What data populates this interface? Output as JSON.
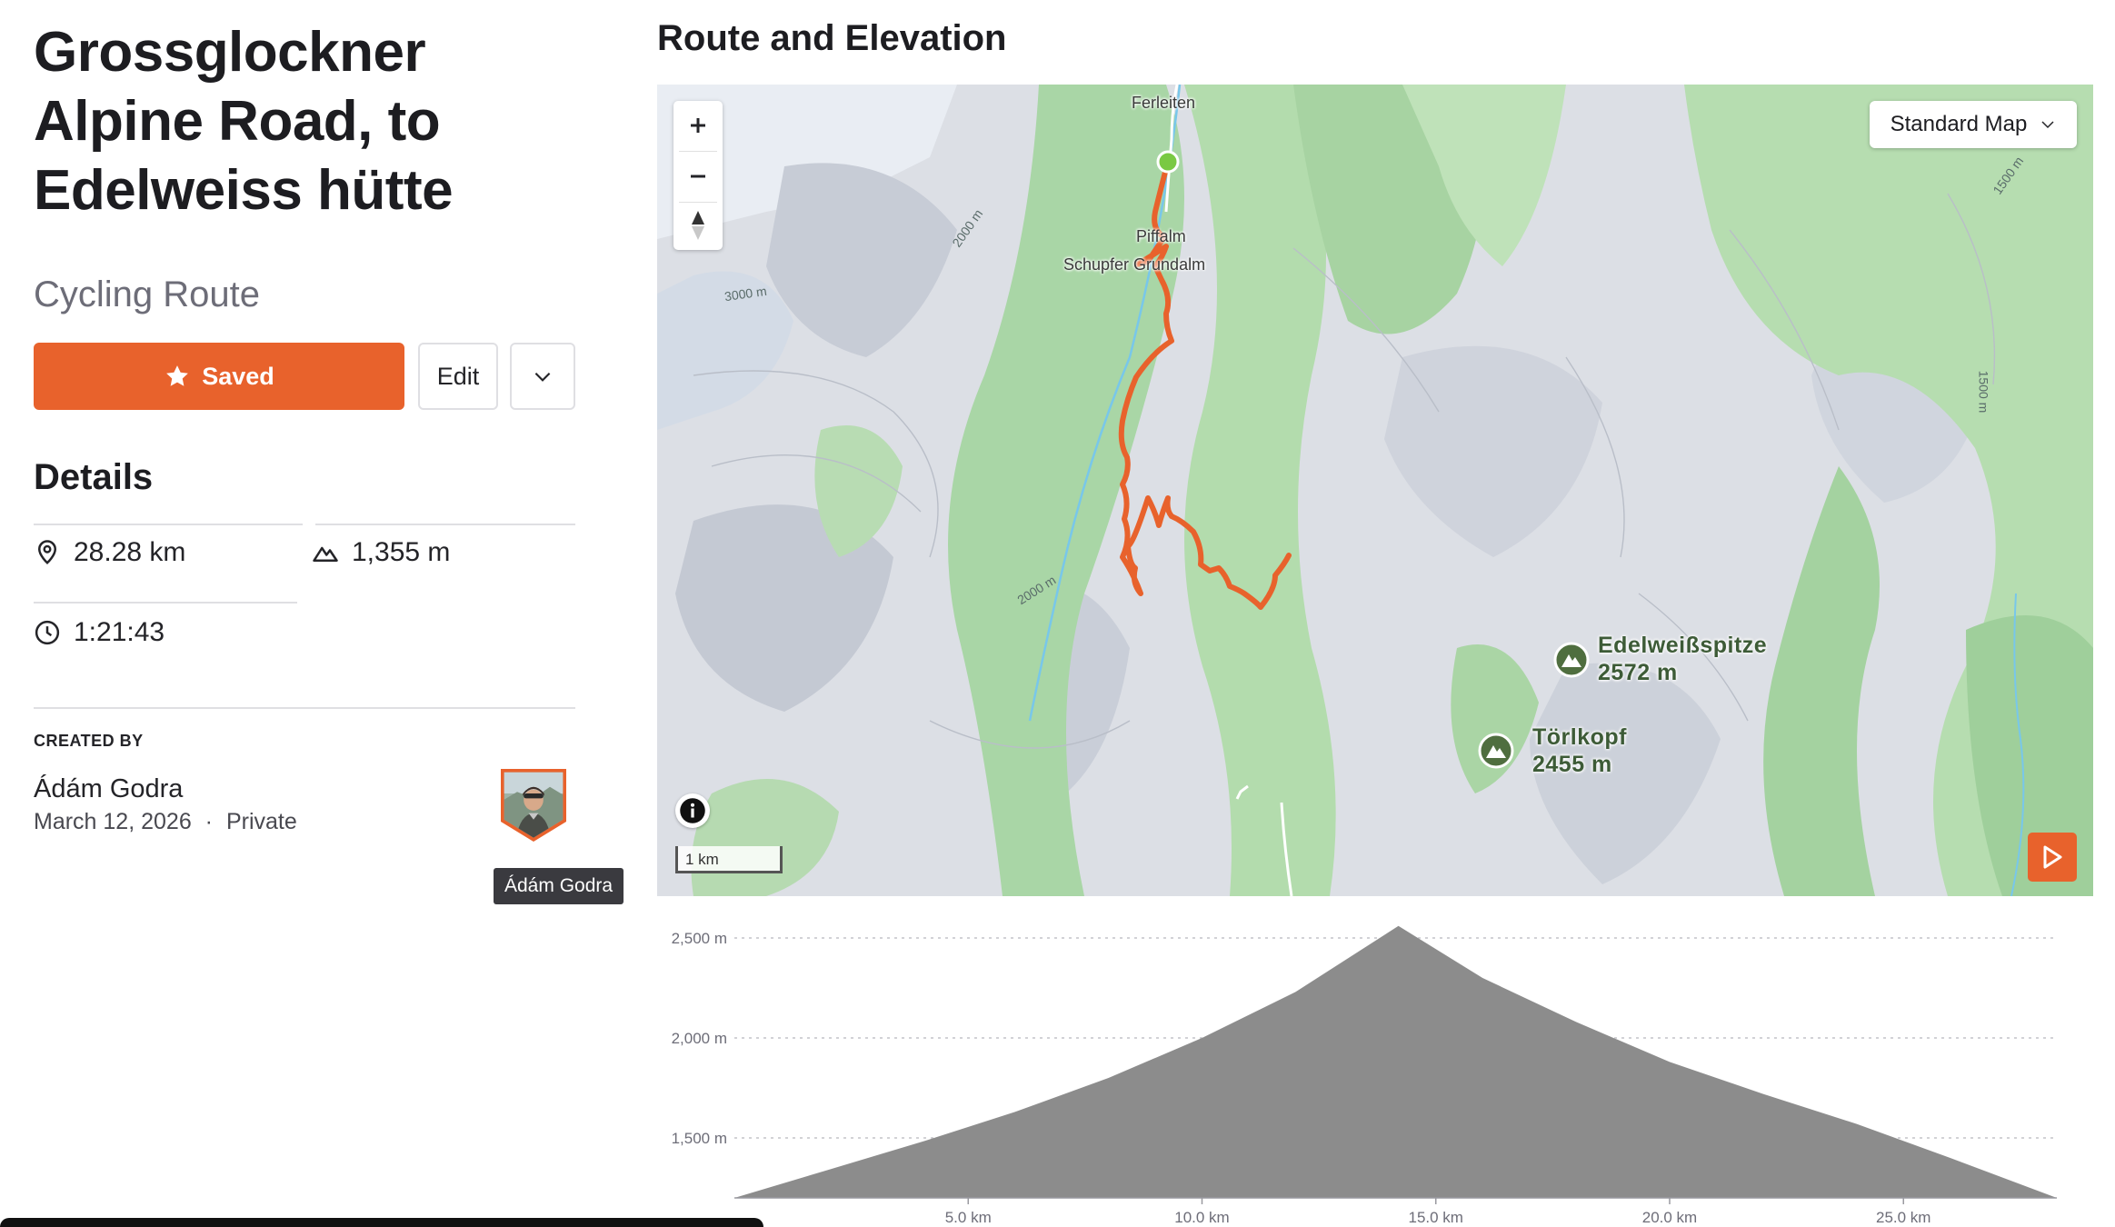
{
  "route": {
    "title": "Grossglockner Alpine Road, to Edelweiss hütte",
    "type": "Cycling Route"
  },
  "actions": {
    "saved_label": "Saved",
    "edit_label": "Edit"
  },
  "details": {
    "title": "Details",
    "distance": "28.28 km",
    "elevation_gain": "1,355 m",
    "moving_time": "1:21:43"
  },
  "creator": {
    "heading": "CREATED BY",
    "name": "Ádám Godra",
    "date": "March 12, 2026",
    "separator": "·",
    "visibility": "Private",
    "tooltip": "Ádám Godra"
  },
  "map": {
    "section_title": "Route and Elevation",
    "style_selector": "Standard Map",
    "scale_label": "1 km",
    "places": [
      "Ferleiten",
      "Piffalm",
      "Schupfer Grundalm"
    ],
    "contours": [
      "2000 m",
      "3000 m",
      "1500 m",
      "1500 m",
      "2000 m"
    ],
    "pois": [
      {
        "name": "Edelweißspitze",
        "elevation": "2572 m"
      },
      {
        "name": "Törlkopf",
        "elevation": "2455 m"
      }
    ],
    "colors": {
      "route": "#e8622c",
      "start": "#7ac943",
      "poi": "#4f6e3f"
    }
  },
  "chart_data": {
    "type": "area",
    "ylabels": [
      "2,500 m",
      "2,000 m",
      "1,500 m"
    ],
    "xlabels": [
      "5.0 km",
      "10.0 km",
      "15.0 km",
      "20.0 km",
      "25.0 km"
    ],
    "xlim": [
      0,
      28.28
    ],
    "ylim": [
      1200,
      2600
    ],
    "x": [
      0,
      2,
      4,
      6,
      8,
      10,
      12,
      14.2,
      16,
      18,
      20,
      22,
      24,
      26,
      28.28
    ],
    "y": [
      1200,
      1340,
      1480,
      1630,
      1800,
      2000,
      2230,
      2560,
      2300,
      2080,
      1880,
      1720,
      1570,
      1400,
      1200
    ],
    "fill": "#8c8c8c",
    "grid": true
  }
}
